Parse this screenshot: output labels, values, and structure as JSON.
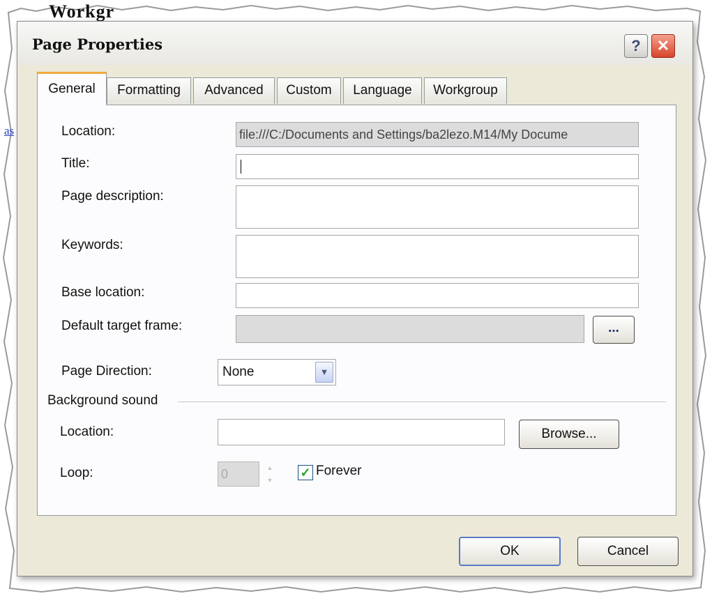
{
  "background": {
    "title_fragment": "Workgr",
    "link_fragment": "as"
  },
  "dialog": {
    "title": "Page Properties",
    "help_icon_glyph": "?",
    "close_icon_glyph": "✕"
  },
  "tabs": [
    {
      "label": "General",
      "active": true
    },
    {
      "label": "Formatting",
      "active": false
    },
    {
      "label": "Advanced",
      "active": false
    },
    {
      "label": "Custom",
      "active": false
    },
    {
      "label": "Language",
      "active": false
    },
    {
      "label": "Workgroup",
      "active": false
    }
  ],
  "general": {
    "location_label": "Location:",
    "location_value": "file:///C:/Documents and Settings/ba2lezo.M14/My Docume",
    "title_label": "Title:",
    "title_value": "",
    "description_label": "Page description:",
    "description_value": "",
    "keywords_label": "Keywords:",
    "keywords_value": "",
    "base_location_label": "Base location:",
    "base_location_value": "",
    "target_frame_label": "Default target frame:",
    "target_frame_value": "",
    "target_frame_button": "...",
    "page_direction_label": "Page Direction:",
    "page_direction_value": "None",
    "page_direction_arrow": "▼"
  },
  "background_sound": {
    "group_label": "Background sound",
    "location_label": "Location:",
    "location_value": "",
    "browse_button": "Browse...",
    "loop_label": "Loop:",
    "loop_value": "0",
    "spin_up": "▲",
    "spin_down": "▼",
    "forever_label": "Forever",
    "forever_checked": true,
    "forever_check_glyph": "✓"
  },
  "footer": {
    "ok_button": "OK",
    "cancel_button": "Cancel"
  },
  "colors": {
    "dialog_face": "#ece9d8",
    "tab_highlight": "#f3a93c",
    "close_red": "#d8442b",
    "default_button_border": "#5b79c9",
    "check_green": "#21a121"
  }
}
